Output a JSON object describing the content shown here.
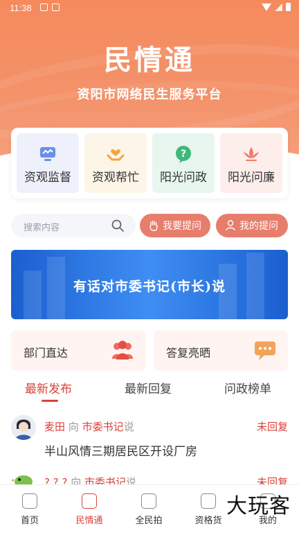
{
  "status_bar": {
    "time": "11:38"
  },
  "header": {
    "title": "民情通",
    "subtitle": "资阳市网络民生服务平台"
  },
  "services": [
    {
      "label": "资观监督",
      "icon": "monitor-icon"
    },
    {
      "label": "资观帮忙",
      "icon": "hands-heart-icon"
    },
    {
      "label": "阳光问政",
      "icon": "question-bubble-icon"
    },
    {
      "label": "阳光问廉",
      "icon": "lotus-icon"
    }
  ],
  "search": {
    "placeholder": "搜索内容"
  },
  "actions": {
    "ask_label": "我要提问",
    "my_questions_label": "我的提问"
  },
  "banner": {
    "text": "有话对市委书记(市长)说"
  },
  "quick": {
    "dept_label": "部门直达",
    "reply_label": "答复亮晒"
  },
  "tabs": [
    {
      "label": "最新发布"
    },
    {
      "label": "最新回复"
    },
    {
      "label": "问政榜单"
    }
  ],
  "posts": [
    {
      "user": "麦田",
      "to_word": "向",
      "target": "市委书记",
      "said": "说",
      "status": "未回复",
      "title": "半山风情三期居民区开设厂房"
    },
    {
      "user": "? ? ?",
      "to_word": "向",
      "target": "市委书记",
      "said": "说",
      "status": "未回复",
      "title": ""
    }
  ],
  "bottom_nav": [
    {
      "label": "首页"
    },
    {
      "label": "民情通"
    },
    {
      "label": "全民拍"
    },
    {
      "label": "资格货"
    },
    {
      "label": "我的"
    }
  ],
  "watermark": "大玩客",
  "colors": {
    "accent": "#d9423a",
    "header": "#f58a5c",
    "pill": "#e77d6c",
    "banner": "#2f7be6"
  }
}
